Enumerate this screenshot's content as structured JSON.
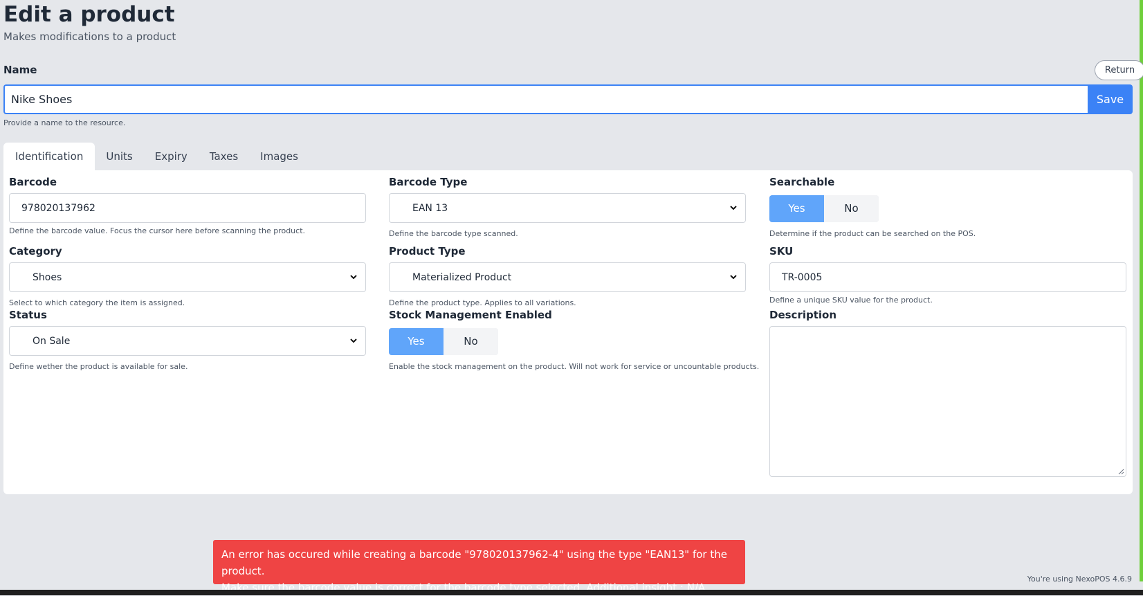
{
  "header": {
    "title": "Edit a product",
    "subtitle": "Makes modifications to a product"
  },
  "name_section": {
    "label": "Name",
    "return_label": "Return",
    "value": "Nike Shoes",
    "save_label": "Save",
    "help": "Provide a name to the resource."
  },
  "tabs": [
    {
      "label": "Identification",
      "active": true
    },
    {
      "label": "Units",
      "active": false
    },
    {
      "label": "Expiry",
      "active": false
    },
    {
      "label": "Taxes",
      "active": false
    },
    {
      "label": "Images",
      "active": false
    }
  ],
  "fields": {
    "barcode": {
      "label": "Barcode",
      "value": "978020137962",
      "help": "Define the barcode value. Focus the cursor here before scanning the product."
    },
    "barcode_type": {
      "label": "Barcode Type",
      "value": "EAN 13",
      "help": "Define the barcode type scanned."
    },
    "searchable": {
      "label": "Searchable",
      "yes": "Yes",
      "no": "No",
      "selected": "Yes",
      "help": "Determine if the product can be searched on the POS."
    },
    "category": {
      "label": "Category",
      "value": "Shoes",
      "help": "Select to which category the item is assigned."
    },
    "product_type": {
      "label": "Product Type",
      "value": "Materialized Product",
      "help": "Define the product type. Applies to all variations."
    },
    "sku": {
      "label": "SKU",
      "value": "TR-0005",
      "help": "Define a unique SKU value for the product."
    },
    "status": {
      "label": "Status",
      "value": "On Sale",
      "help": "Define wether the product is available for sale."
    },
    "stock_management": {
      "label": "Stock Management Enabled",
      "yes": "Yes",
      "no": "No",
      "selected": "Yes",
      "help": "Enable the stock management on the product. Will not work for service or uncountable products."
    },
    "description": {
      "label": "Description",
      "value": ""
    }
  },
  "error_toast": {
    "line1": "An error has occured while creating a barcode \"978020137962-4\" using the type \"EAN13\" for the product.",
    "line2": "Make sure the barcode value is correct for the barcode type selected. Additional insight : N/A"
  },
  "footer": {
    "version": "You're using NexoPOS 4.6.9"
  },
  "colors": {
    "accent": "#3b82f6",
    "toggle_on": "#60a5fa",
    "error": "#ef4444",
    "background": "#e5e7eb"
  }
}
